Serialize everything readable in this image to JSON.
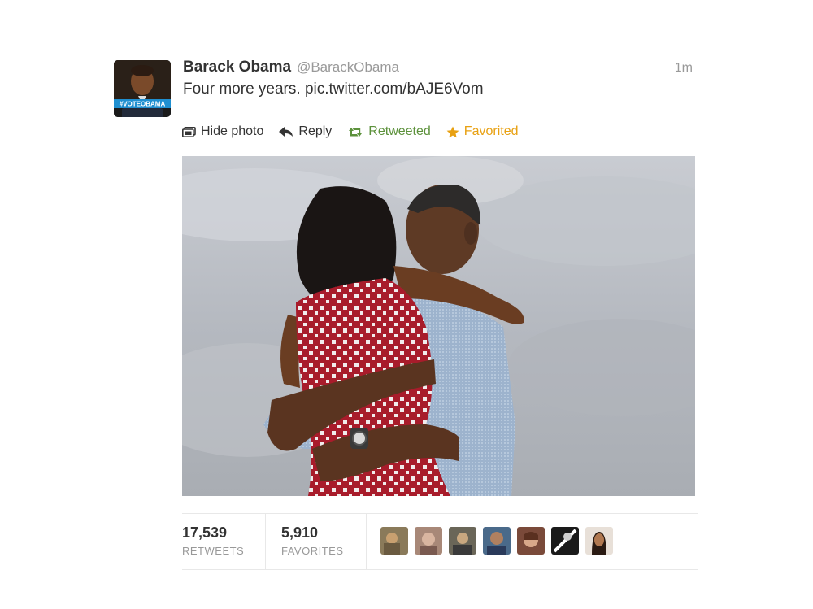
{
  "tweet": {
    "avatar": {
      "badge": "#VOTEOBAMA"
    },
    "full_name": "Barack Obama",
    "handle": "@BarackObama",
    "time": "1m",
    "text": "Four more years.",
    "link": "pic.twitter.com/bAJE6Vom"
  },
  "actions": {
    "hide_photo": "Hide photo",
    "reply": "Reply",
    "retweeted": "Retweeted",
    "favorited": "Favorited"
  },
  "colors": {
    "retweet_green": "#5c913b",
    "favorite_orange": "#e8a113"
  },
  "stats": {
    "retweets_count": "17,539",
    "retweets_label": "RETWEETS",
    "favorites_count": "5,910",
    "favorites_label": "FAVORITES"
  },
  "favoriters": [
    "favoriter-1",
    "favoriter-2",
    "favoriter-3",
    "favoriter-4",
    "favoriter-5",
    "favoriter-6",
    "favoriter-7"
  ]
}
